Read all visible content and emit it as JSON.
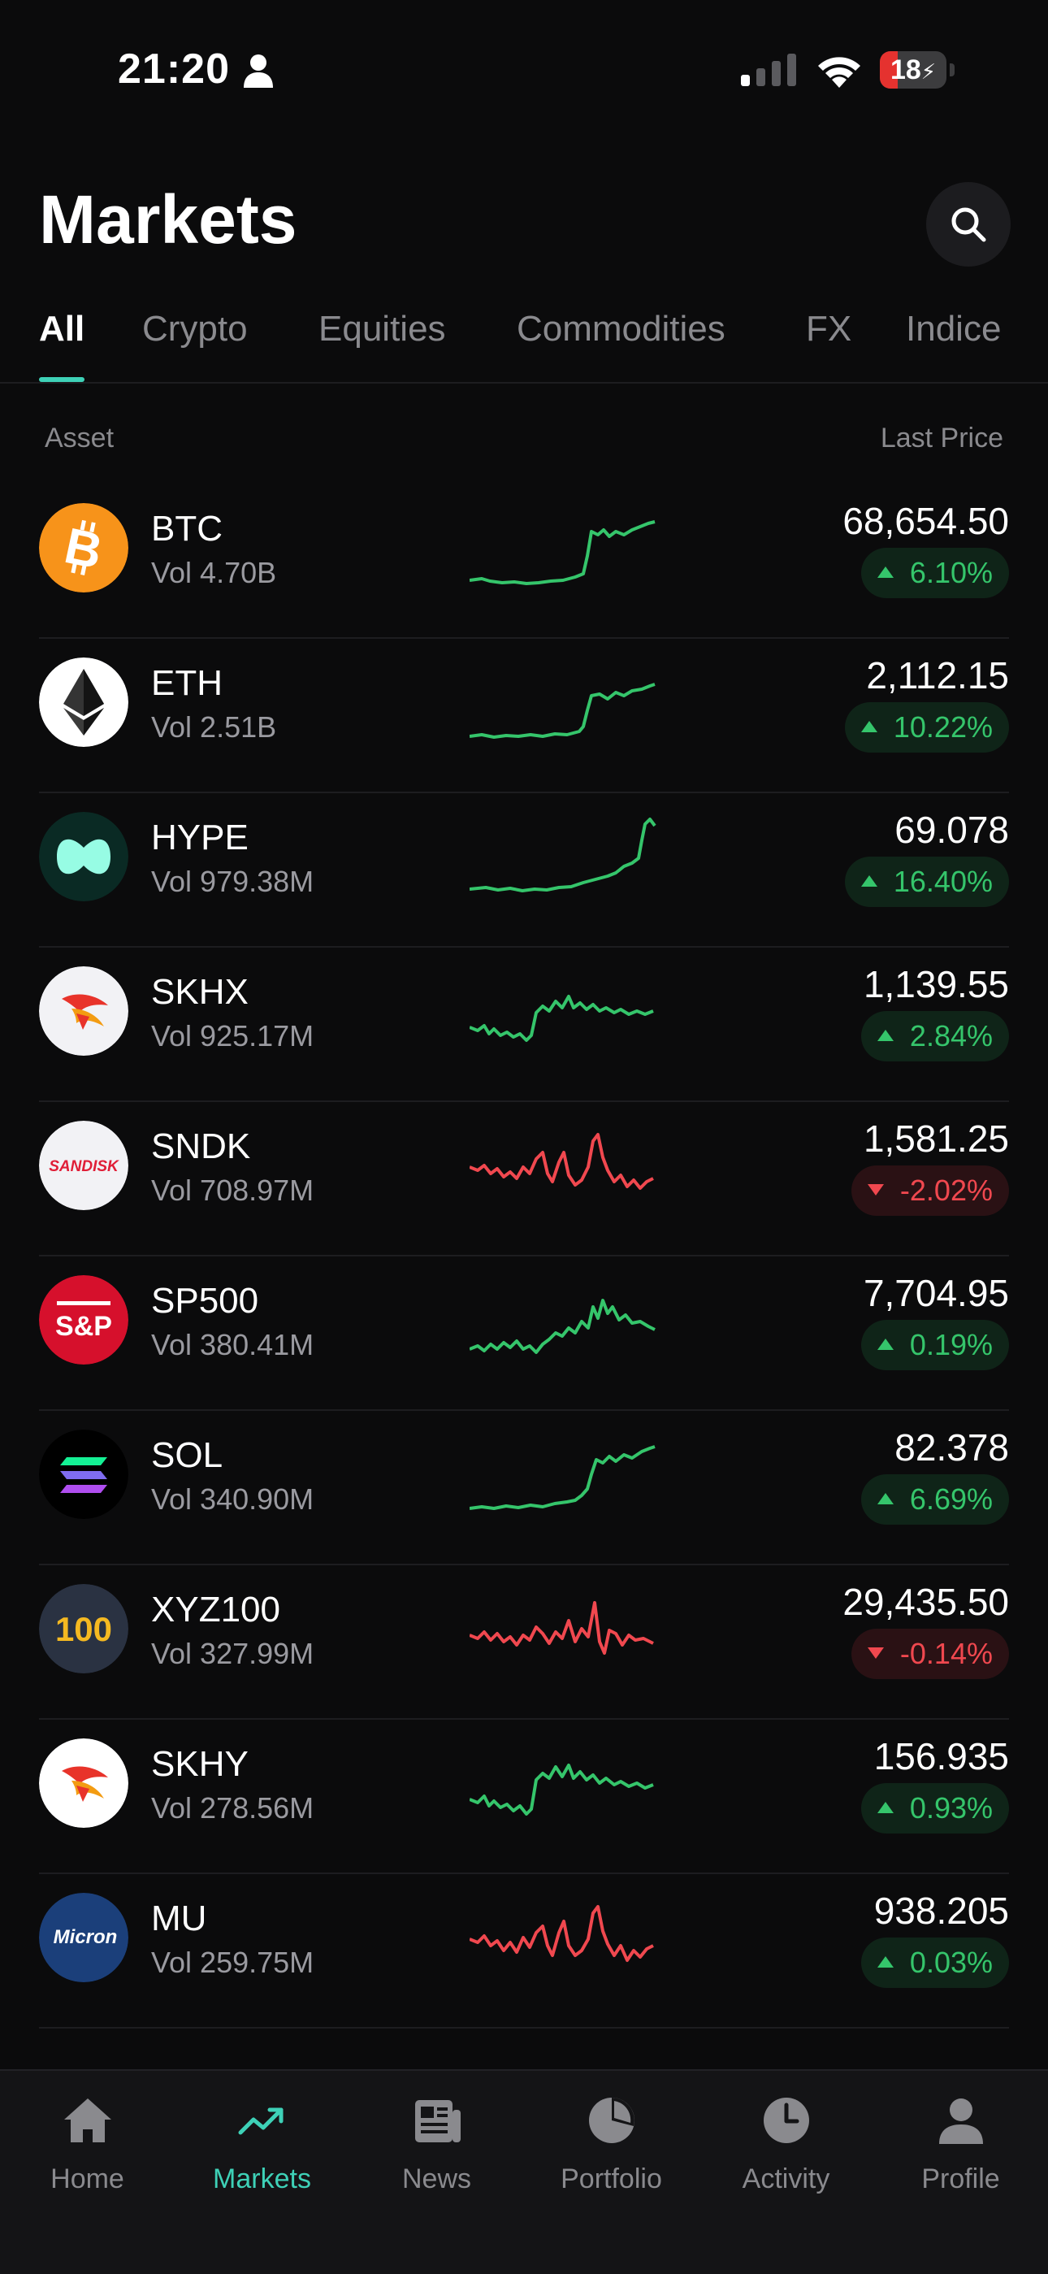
{
  "status_bar": {
    "time": "21:20",
    "battery": "18"
  },
  "header": {
    "title": "Markets"
  },
  "tabs": [
    "All",
    "Crypto",
    "Equities",
    "Commodities",
    "FX",
    "Indice"
  ],
  "columns": {
    "asset": "Asset",
    "last_price": "Last Price"
  },
  "colors": {
    "accent": "#3ed1b7",
    "up": "#35c56b",
    "down": "#f0484f"
  },
  "assets": [
    {
      "symbol": "BTC",
      "volume": "Vol 4.70B",
      "price": "68,654.50",
      "change": "6.10%",
      "direction": "up",
      "logo": "bitcoin-logo"
    },
    {
      "symbol": "ETH",
      "volume": "Vol 2.51B",
      "price": "2,112.15",
      "change": "10.22%",
      "direction": "up",
      "logo": "ethereum-logo"
    },
    {
      "symbol": "HYPE",
      "volume": "Vol 979.38M",
      "price": "69.078",
      "change": "16.40%",
      "direction": "up",
      "logo": "hyperliquid-logo"
    },
    {
      "symbol": "SKHX",
      "volume": "Vol 925.17M",
      "price": "1,139.55",
      "change": "2.84%",
      "direction": "up",
      "logo": "sk-hynix-logo"
    },
    {
      "symbol": "SNDK",
      "volume": "Vol 708.97M",
      "price": "1,581.25",
      "change": "-2.02%",
      "direction": "down",
      "logo": "sandisk-logo",
      "logo_text": "SANDISK"
    },
    {
      "symbol": "SP500",
      "volume": "Vol 380.41M",
      "price": "7,704.95",
      "change": "0.19%",
      "direction": "up",
      "logo": "sp-logo",
      "logo_text": "S&P"
    },
    {
      "symbol": "SOL",
      "volume": "Vol 340.90M",
      "price": "82.378",
      "change": "6.69%",
      "direction": "up",
      "logo": "solana-logo"
    },
    {
      "symbol": "XYZ100",
      "volume": "Vol 327.99M",
      "price": "29,435.50",
      "change": "-0.14%",
      "direction": "down",
      "logo": "xyz100-logo",
      "logo_text": "100"
    },
    {
      "symbol": "SKHY",
      "volume": "Vol 278.56M",
      "price": "156.935",
      "change": "0.93%",
      "direction": "up",
      "logo": "sk-hynix-logo"
    },
    {
      "symbol": "MU",
      "volume": "Vol 259.75M",
      "price": "938.205",
      "change": "0.03%",
      "direction": "up",
      "logo": "micron-logo",
      "logo_text": "Micron"
    }
  ],
  "nav": [
    {
      "label": "Home",
      "icon": "home-icon"
    },
    {
      "label": "Markets",
      "icon": "trend-icon",
      "active": true
    },
    {
      "label": "News",
      "icon": "news-icon"
    },
    {
      "label": "Portfolio",
      "icon": "pie-icon"
    },
    {
      "label": "Activity",
      "icon": "clock-icon"
    },
    {
      "label": "Profile",
      "icon": "person-icon"
    }
  ]
}
